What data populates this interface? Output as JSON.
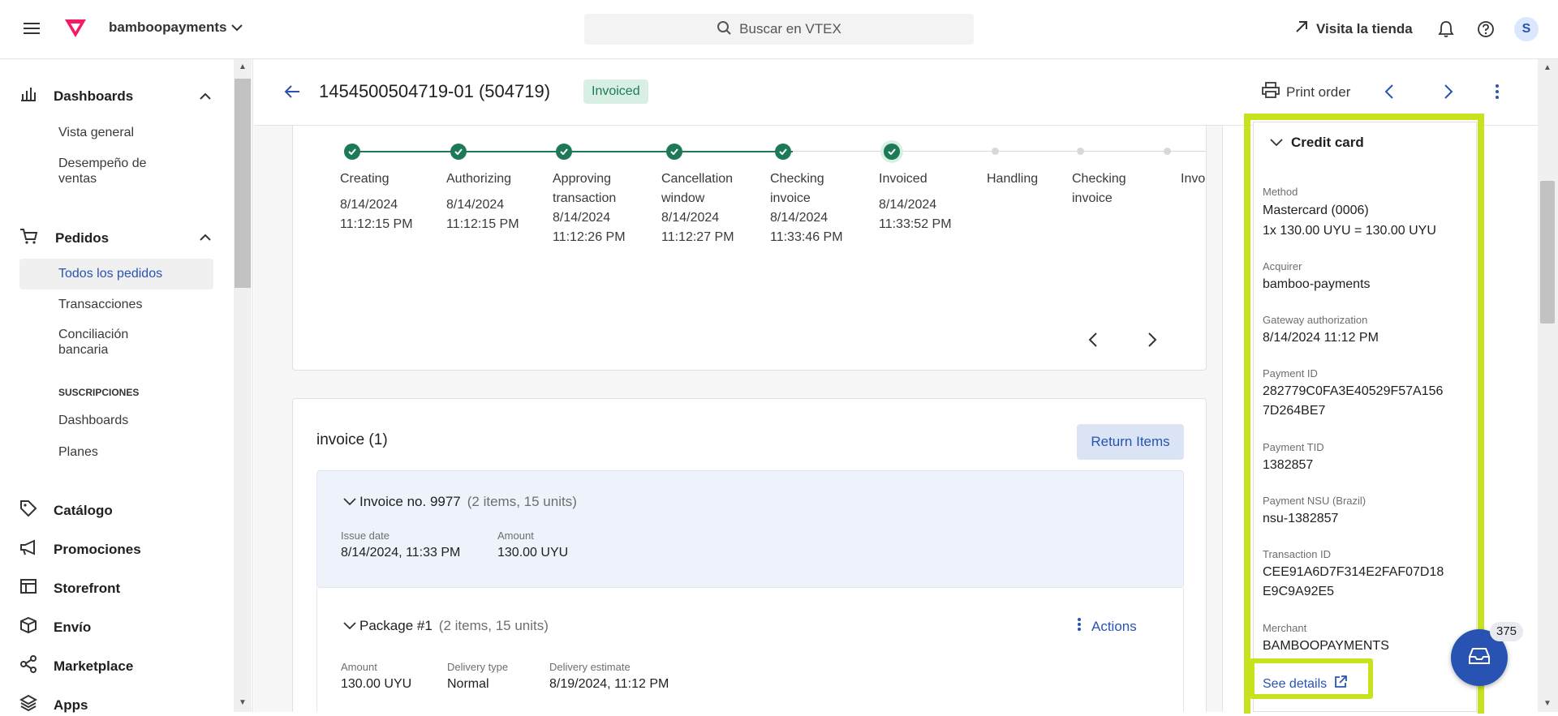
{
  "header": {
    "account": "bamboopayments",
    "search_placeholder": "Buscar en VTEX",
    "visit_store": "Visita la tienda",
    "avatar": "S"
  },
  "sidebar": {
    "dashboards": "Dashboards",
    "vista_general": "Vista general",
    "desempeno": "Desempeño de ventas",
    "pedidos": "Pedidos",
    "todos": "Todos los pedidos",
    "transacciones": "Transacciones",
    "conciliacion": "Conciliación bancaria",
    "suscripciones": "SUSCRIPCIONES",
    "sus_dashboards": "Dashboards",
    "planes": "Planes",
    "catalogo": "Catálogo",
    "promociones": "Promociones",
    "storefront": "Storefront",
    "envio": "Envío",
    "marketplace": "Marketplace",
    "apps": "Apps"
  },
  "order": {
    "title": "1454500504719-01 (504719)",
    "status": "Invoiced",
    "print": "Print order"
  },
  "timeline": [
    {
      "name": "Creating",
      "date": "8/14/2024",
      "time": "11:12:15 PM"
    },
    {
      "name": "Authorizing",
      "date": "8/14/2024",
      "time": "11:12:15 PM"
    },
    {
      "name": "Approving transaction",
      "date": "8/14/2024",
      "time": "11:12:26 PM"
    },
    {
      "name": "Cancellation window",
      "date": "8/14/2024",
      "time": "11:12:27 PM"
    },
    {
      "name": "Checking invoice",
      "date": "8/14/2024",
      "time": "11:33:46 PM"
    },
    {
      "name": "Invoiced",
      "date": "8/14/2024",
      "time": "11:33:52 PM"
    },
    {
      "name": "Handling",
      "date": "",
      "time": ""
    },
    {
      "name": "Checking invoice",
      "date": "",
      "time": ""
    },
    {
      "name": "Invo",
      "date": "",
      "time": ""
    }
  ],
  "invoice": {
    "title": "invoice (1)",
    "return_btn": "Return Items",
    "inv_title": "Invoice no. 9977",
    "inv_count": "(2 items, 15 units)",
    "issue_lbl": "Issue date",
    "issue_val": "8/14/2024, 11:33 PM",
    "amount_lbl": "Amount",
    "amount_val": "130.00 UYU",
    "pkg_title": "Package #1",
    "pkg_count": "(2 items, 15 units)",
    "actions": "Actions",
    "pkg_amount_lbl": "Amount",
    "pkg_amount_val": "130.00 UYU",
    "delivery_type_lbl": "Delivery type",
    "delivery_type_val": "Normal",
    "delivery_est_lbl": "Delivery estimate",
    "delivery_est_val": "8/19/2024, 11:12 PM"
  },
  "payment": {
    "title": "Credit card",
    "method_lbl": "Method",
    "method_val1": "Mastercard (0006)",
    "method_val2": "1x 130.00 UYU = 130.00 UYU",
    "acquirer_lbl": "Acquirer",
    "acquirer_val": "bamboo-payments",
    "gateway_lbl": "Gateway authorization",
    "gateway_val": "8/14/2024 11:12 PM",
    "payment_id_lbl": "Payment ID",
    "payment_id_val": "282779C0FA3E40529F57A1567D264BE7",
    "tid_lbl": "Payment TID",
    "tid_val": "1382857",
    "nsu_lbl": "Payment NSU (Brazil)",
    "nsu_val": "nsu-1382857",
    "txn_lbl": "Transaction ID",
    "txn_val": "CEE91A6D7F314E2FAF07D18E9C9A92E5",
    "merchant_lbl": "Merchant",
    "merchant_val": "BAMBOOPAYMENTS",
    "see_details": "See details"
  },
  "fab_badge": "375",
  "colors": {
    "brand": "#f71963",
    "link": "#2953b2",
    "success": "#1d7a56",
    "highlight": "#c8e31e"
  }
}
